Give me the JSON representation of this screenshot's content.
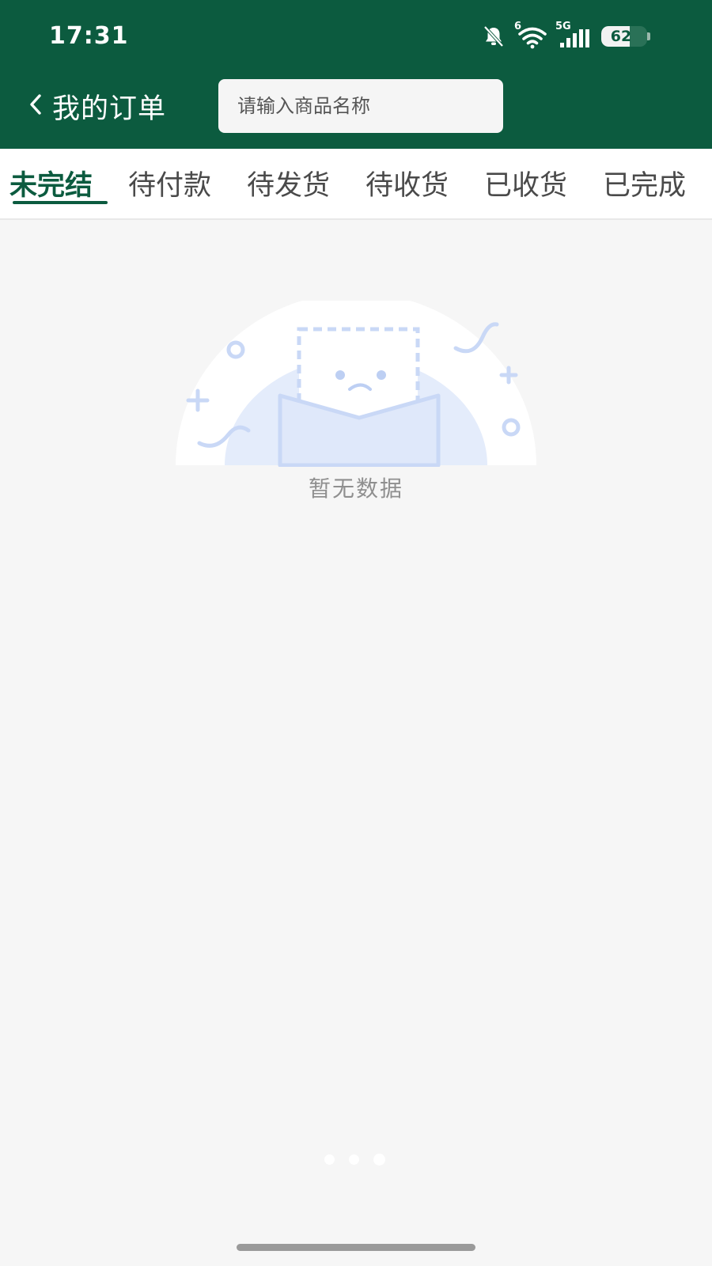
{
  "status_bar": {
    "time": "17:31",
    "wifi_badge": "6",
    "network": "5G",
    "battery": "62"
  },
  "header": {
    "title": "我的订单",
    "search_placeholder": "请输入商品名称"
  },
  "tabs": [
    {
      "label": "未完结",
      "active": true
    },
    {
      "label": "待付款",
      "active": false
    },
    {
      "label": "待发货",
      "active": false
    },
    {
      "label": "待收货",
      "active": false
    },
    {
      "label": "已收货",
      "active": false
    },
    {
      "label": "已完成",
      "active": false
    }
  ],
  "empty_state": {
    "message": "暂无数据"
  },
  "pager": {
    "count": 3,
    "current": 3
  },
  "colors": {
    "brand": "#0c5b3f",
    "background": "#f6f6f6",
    "illustration": "#c9d8f6"
  }
}
